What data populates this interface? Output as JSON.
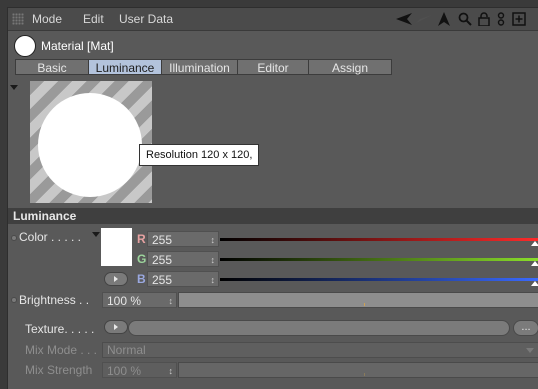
{
  "menubar": {
    "items": [
      "Mode",
      "Edit",
      "User Data"
    ],
    "icons": [
      "back-arrow-icon",
      "forward-arrow-icon",
      "cursor-icon",
      "search-icon",
      "lock-icon",
      "link-icon",
      "new-panel-icon"
    ]
  },
  "material": {
    "title": "Material [Mat]"
  },
  "tabs": [
    {
      "label": "Basic",
      "active": false
    },
    {
      "label": "Luminance",
      "active": true
    },
    {
      "label": "Illumination",
      "active": false
    },
    {
      "label": "Editor",
      "active": false
    },
    {
      "label": "Assign",
      "active": false
    }
  ],
  "preview": {
    "tooltip": "Resolution 120 x 120,"
  },
  "luminance": {
    "section_title": "Luminance",
    "color_label": "Color . . . . .",
    "color_hex": "#ffffff",
    "r_label": "R",
    "g_label": "G",
    "b_label": "B",
    "r_value": "255",
    "g_value": "255",
    "b_value": "255",
    "brightness_label": "Brightness . .",
    "brightness_value": "100 %",
    "brightness_fraction": 1.0,
    "texture_label": "Texture. . . . .",
    "texture_more": "...",
    "mix_mode_label": "Mix Mode . . .",
    "mix_mode_value": "Normal",
    "mix_strength_label": "Mix Strength",
    "mix_strength_value": "100 %",
    "mix_strength_fraction": 1.0
  }
}
